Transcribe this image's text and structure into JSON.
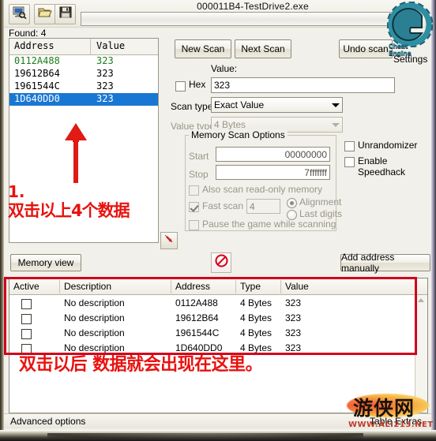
{
  "window": {
    "title": "000011B4-TestDrive2.exe",
    "found_label": "Found: 4"
  },
  "toolbar": {
    "buttons": [
      {
        "name": "open-process",
        "icon": "process-select-icon"
      },
      {
        "name": "open-file",
        "icon": "folder-open-icon"
      },
      {
        "name": "save-file",
        "icon": "floppy-save-icon"
      }
    ],
    "progress_percent": 0
  },
  "address_list": {
    "columns": [
      "Address",
      "Value"
    ],
    "rows": [
      {
        "address": "0112A488",
        "value": "323",
        "state": "new"
      },
      {
        "address": "19612B64",
        "value": "323",
        "state": "normal"
      },
      {
        "address": "1961544C",
        "value": "323",
        "state": "normal"
      },
      {
        "address": "1D640DD0",
        "value": "323",
        "state": "selected"
      }
    ]
  },
  "scan": {
    "new_scan": "New Scan",
    "next_scan": "Next Scan",
    "undo_scan": "Undo scan",
    "settings_label": "Settings",
    "logo_word": "Cheat Engine",
    "value_label": "Value:",
    "hex_label": "Hex",
    "hex_checked": false,
    "value_input": "323",
    "scan_type_label": "Scan type",
    "scan_type_value": "Exact Value",
    "value_type_label": "Value type",
    "value_type_value": "4 Bytes"
  },
  "memory_scan_options": {
    "group_title": "Memory Scan Options",
    "start_label": "Start",
    "start_value": "00000000",
    "stop_label": "Stop",
    "stop_value": "7fffffff",
    "readonly_label": "Also scan read-only memory",
    "readonly_checked": false,
    "fast_scan_label": "Fast scan",
    "fast_scan_checked": true,
    "fast_scan_value": "4",
    "alignment_label": "Alignment",
    "alignment_selected": true,
    "last_digits_label": "Last digits",
    "last_digits_selected": false,
    "pause_label": "Pause the game while scanning",
    "pause_checked": false
  },
  "extras": {
    "unrandomizer_label": "Unrandomizer",
    "unrandomizer_checked": false,
    "speedhack_label": "Enable Speedhack",
    "speedhack_checked": false
  },
  "midbar": {
    "memory_view": "Memory view",
    "add_address": "Add address manually",
    "stop_icon": "no-entry-icon"
  },
  "cheat_table": {
    "columns": [
      "Active",
      "Description",
      "Address",
      "Type",
      "Value"
    ],
    "rows": [
      {
        "active": false,
        "description": "No description",
        "address": "0112A488",
        "type": "4 Bytes",
        "value": "323"
      },
      {
        "active": false,
        "description": "No description",
        "address": "19612B64",
        "type": "4 Bytes",
        "value": "323"
      },
      {
        "active": false,
        "description": "No description",
        "address": "1961544C",
        "type": "4 Bytes",
        "value": "323"
      },
      {
        "active": false,
        "description": "No description",
        "address": "1D640DD0",
        "type": "4 Bytes",
        "value": "323"
      }
    ]
  },
  "statusbar": {
    "advanced_options": "Advanced options",
    "table_extras": "Table Extras"
  },
  "annotations": {
    "step_number": "1.",
    "step_text": "双击以上4个数据",
    "bottom_text": "双击以后 数据就会出现在这里。",
    "arrow": "up-arrow-annotation"
  },
  "watermark": {
    "cn": "游侠网",
    "url": "WWW.ALI213.NET"
  },
  "colors": {
    "annotation_red": "#e8120f",
    "highlight_blue": "#1977d4",
    "new_result_green": "#1a7d1a",
    "logo_teal": "#2b7a8c",
    "redbox": "#d0021b"
  }
}
